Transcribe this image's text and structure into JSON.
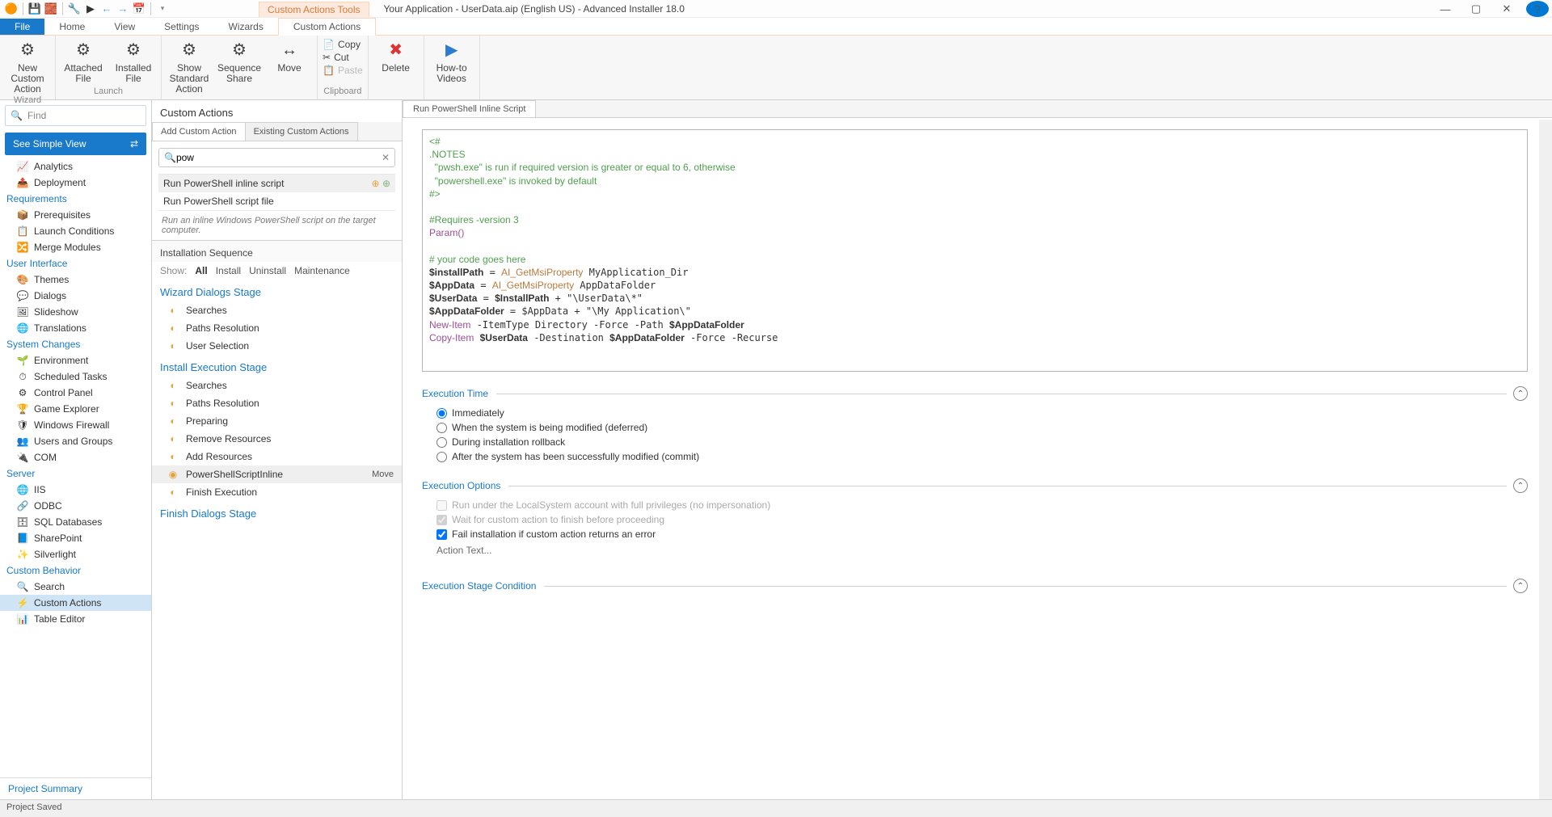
{
  "title": "Your Application - UserData.aip (English US) - Advanced Installer 18.0",
  "context_tab": "Custom Actions Tools",
  "ribbon_tabs": [
    "File",
    "Home",
    "View",
    "Settings",
    "Wizards",
    "Custom Actions"
  ],
  "ribbon": {
    "wizard_group": "Wizard",
    "new_custom": "New Custom Action",
    "launch_group": "Launch",
    "attached": "Attached File",
    "installed": "Installed File",
    "show_standard": "Show Standard Action",
    "seq_share": "Sequence Share",
    "move": "Move",
    "clipboard_group": "Clipboard",
    "copy": "Copy",
    "cut": "Cut",
    "paste": "Paste",
    "delete": "Delete",
    "howto": "How-to Videos"
  },
  "left": {
    "find_placeholder": "Find",
    "simple_view": "See Simple View",
    "sections": [
      {
        "hdr": null,
        "items": [
          {
            "ic": "📈",
            "t": "Analytics"
          },
          {
            "ic": "📤",
            "t": "Deployment"
          }
        ]
      },
      {
        "hdr": "Requirements",
        "items": [
          {
            "ic": "📦",
            "t": "Prerequisites"
          },
          {
            "ic": "📋",
            "t": "Launch Conditions"
          },
          {
            "ic": "🔀",
            "t": "Merge Modules"
          }
        ]
      },
      {
        "hdr": "User Interface",
        "items": [
          {
            "ic": "🎨",
            "t": "Themes"
          },
          {
            "ic": "💬",
            "t": "Dialogs"
          },
          {
            "ic": "🖼",
            "t": "Slideshow"
          },
          {
            "ic": "🌐",
            "t": "Translations"
          }
        ]
      },
      {
        "hdr": "System Changes",
        "items": [
          {
            "ic": "🌱",
            "t": "Environment"
          },
          {
            "ic": "⏱",
            "t": "Scheduled Tasks"
          },
          {
            "ic": "⚙",
            "t": "Control Panel"
          },
          {
            "ic": "🏆",
            "t": "Game Explorer"
          },
          {
            "ic": "🛡",
            "t": "Windows Firewall"
          },
          {
            "ic": "👥",
            "t": "Users and Groups"
          },
          {
            "ic": "🔌",
            "t": "COM"
          }
        ]
      },
      {
        "hdr": "Server",
        "items": [
          {
            "ic": "🌐",
            "t": "IIS"
          },
          {
            "ic": "🔗",
            "t": "ODBC"
          },
          {
            "ic": "🗄",
            "t": "SQL Databases"
          },
          {
            "ic": "📘",
            "t": "SharePoint"
          },
          {
            "ic": "✨",
            "t": "Silverlight"
          }
        ]
      },
      {
        "hdr": "Custom Behavior",
        "items": [
          {
            "ic": "🔍",
            "t": "Search"
          },
          {
            "ic": "⚡",
            "t": "Custom Actions",
            "sel": true
          },
          {
            "ic": "📊",
            "t": "Table Editor"
          }
        ]
      }
    ],
    "project_summary": "Project Summary"
  },
  "mid": {
    "hdr": "Custom Actions",
    "tab_add": "Add Custom Action",
    "tab_existing": "Existing Custom Actions",
    "search": "pow",
    "results": [
      {
        "t": "Run PowerShell inline script",
        "sel": true
      },
      {
        "t": "Run PowerShell script file"
      }
    ],
    "desc": "Run an inline Windows PowerShell script on the target computer.",
    "seq_hdr": "Installation Sequence",
    "show": "Show:",
    "show_opts": [
      "All",
      "Install",
      "Uninstall",
      "Maintenance"
    ],
    "stage1": "Wizard Dialogs Stage",
    "s1": [
      "Searches",
      "Paths Resolution",
      "User Selection"
    ],
    "stage2": "Install Execution Stage",
    "s2": [
      "Searches",
      "Paths Resolution",
      "Preparing",
      "Remove Resources",
      "Add Resources",
      "PowerShellScriptInline",
      "Finish Execution"
    ],
    "s2_sel": "PowerShellScriptInline",
    "move": "Move",
    "stage3": "Finish Dialogs Stage"
  },
  "right": {
    "tab": "Run PowerShell Inline Script",
    "code": {
      "l1": "<#",
      "l2": ".NOTES",
      "l3": "  \"pwsh.exe\" is run if required version is greater or equal to 6, otherwise",
      "l4": "  \"powershell.exe\" is invoked by default",
      "l5": "#>",
      "req": "#Requires -version 3",
      "param": "Param()",
      "cmt": "# your code goes here",
      "p1a": "$installPath = ",
      "p1b": "AI_GetMsiProperty",
      "p1c": " MyApplication_Dir",
      "p2a": "$AppData = ",
      "p2b": "AI_GetMsiProperty",
      "p2c": " AppDataFolder",
      "p3": "$UserData = $InstallPath + \"\\UserData\\*\"",
      "p4": "$AppDataFolder = $AppData + \"\\My Application\\\"",
      "p5a": "New-Item",
      "p5b": " -ItemType Directory -Force -Path $AppDataFolder",
      "p6a": "Copy-Item",
      "p6b": " $UserData -Destination $AppDataFolder -Force -Recurse"
    },
    "sect_time": "Execution Time",
    "time_opts": [
      "Immediately",
      "When the system is being modified (deferred)",
      "During installation rollback",
      "After the system has been successfully modified (commit)"
    ],
    "sect_opts": "Execution Options",
    "opt1": "Run under the LocalSystem account with full privileges (no impersonation)",
    "opt2": "Wait for custom action to finish before proceeding",
    "opt3": "Fail installation if custom action returns an error",
    "action_text": "Action Text...",
    "sect_stage": "Execution Stage Condition"
  },
  "status": "Project Saved"
}
